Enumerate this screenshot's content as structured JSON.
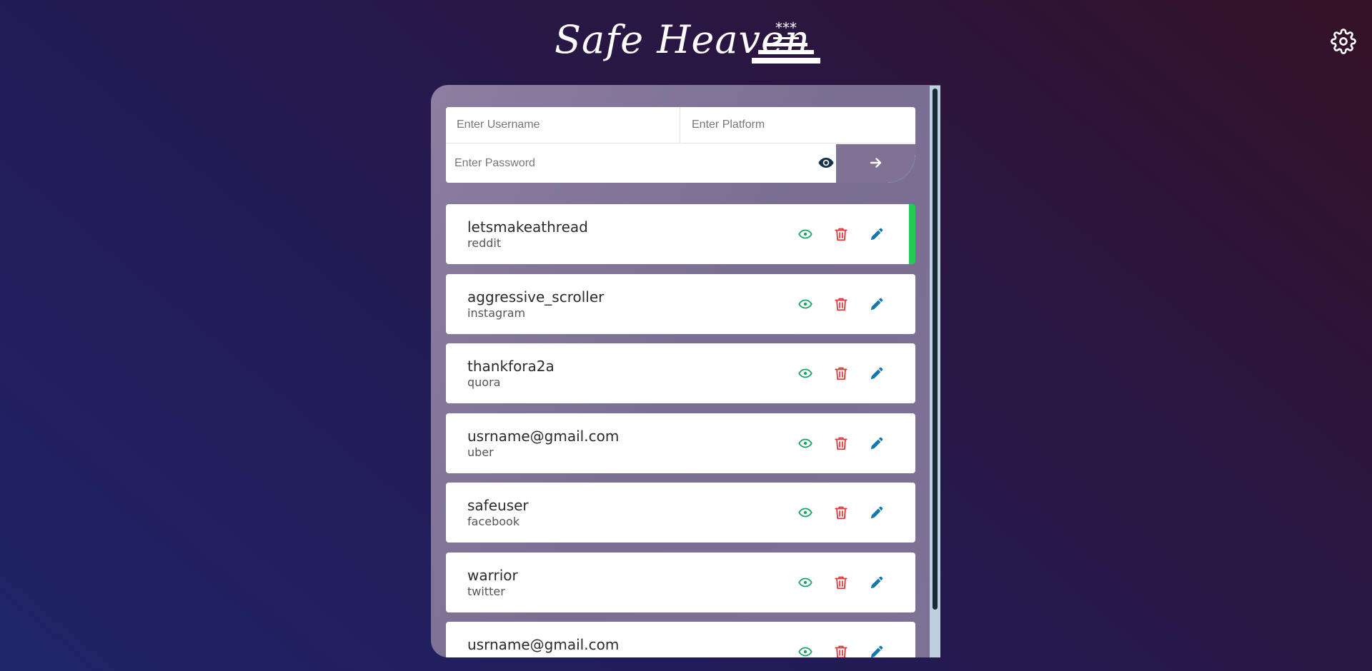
{
  "app": {
    "title": "Safe Heaven",
    "logo_text": "***"
  },
  "form": {
    "username_placeholder": "Enter Username",
    "platform_placeholder": "Enter Platform",
    "password_placeholder": "Enter Password"
  },
  "entries": [
    {
      "username": "letsmakeathread",
      "platform": "reddit",
      "active": true
    },
    {
      "username": "aggressive_scroller",
      "platform": "instagram"
    },
    {
      "username": "thankfora2a",
      "platform": "quora"
    },
    {
      "username": "usrname@gmail.com",
      "platform": "uber"
    },
    {
      "username": "safeuser",
      "platform": "facebook"
    },
    {
      "username": "warrior",
      "platform": "twitter"
    },
    {
      "username": "usrname@gmail.com",
      "platform": ""
    }
  ],
  "icons": {
    "settings": "gear-icon",
    "show_password": "eye-icon",
    "submit": "arrow-right-icon",
    "view": "eye-icon",
    "delete": "trash-icon",
    "edit": "pencil-icon"
  },
  "colors": {
    "active_indicator": "#22cc55",
    "view_icon": "#1aa567",
    "delete_icon": "#e03a3a",
    "edit_icon": "#1377b0"
  }
}
